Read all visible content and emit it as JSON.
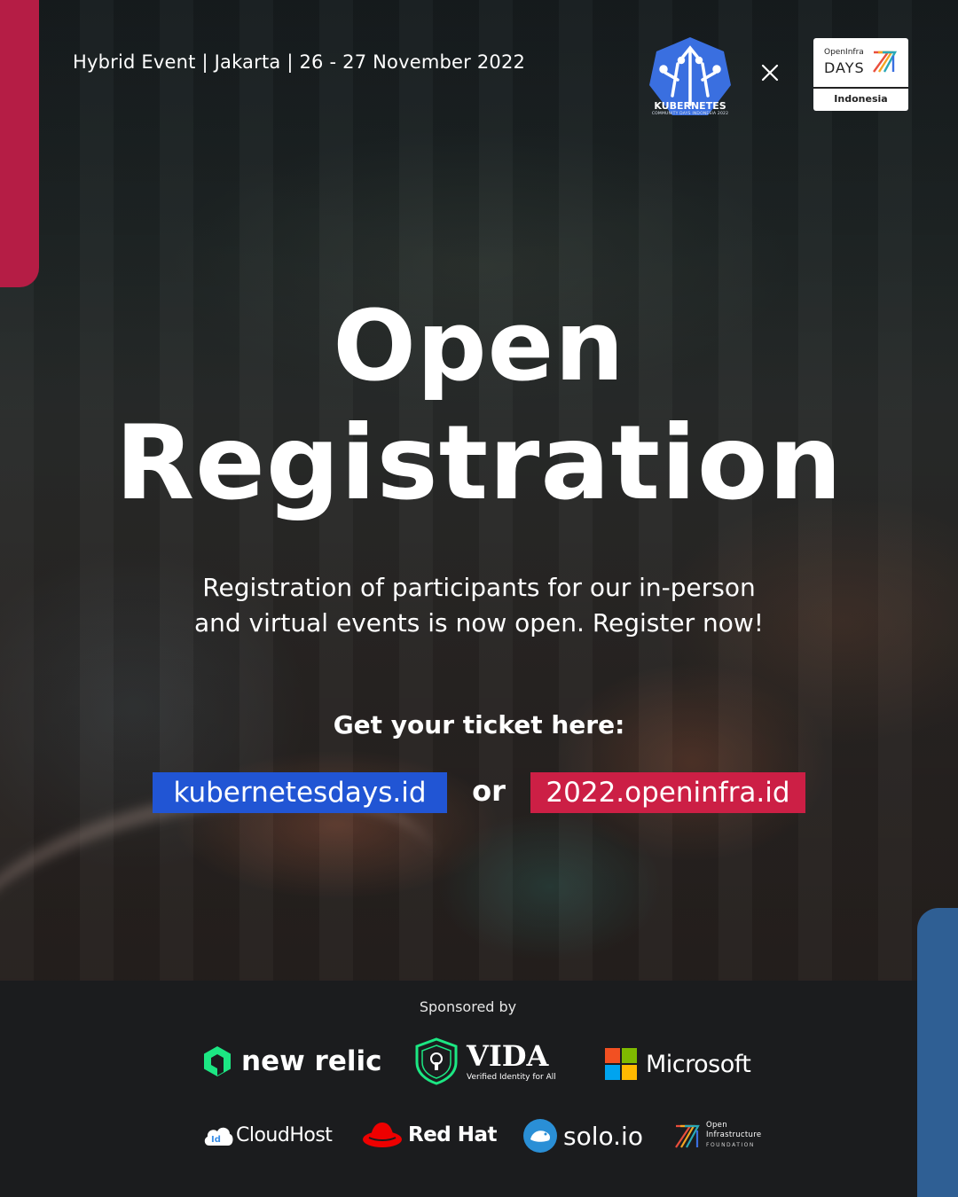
{
  "header": {
    "event_line": "Hybrid Event | Jakarta | 26 - 27 November 2022",
    "kcd_logo": {
      "wordmark": "KUBERNETES",
      "subtitle": "COMMUNITY DAYS INDONESIA 2022",
      "icon": "kubernetes-heptagon-logo"
    },
    "separator_icon": "times-icon",
    "openinfra_badge": {
      "top_text": "OpenInfra",
      "days_text": "DAYS",
      "country": "Indonesia",
      "icon": "openinfra-stripes-logo"
    }
  },
  "headline": {
    "line1": "Open",
    "line2": "Registration"
  },
  "description": {
    "line1": "Registration of participants for our in-person",
    "line2": "and virtual events is now open. Register now!"
  },
  "ticket_prompt": "Get your ticket here:",
  "links": {
    "kubernetes": "kubernetesdays.id",
    "or": "or",
    "openinfra": "2022.openinfra.id"
  },
  "sponsors": {
    "heading": "Sponsored by",
    "row1": [
      {
        "name": "new relic",
        "icon": "new-relic-logo"
      },
      {
        "name": "VIDA",
        "tagline": "Verified Identity for All",
        "icon": "vida-shield-logo"
      },
      {
        "name": "Microsoft",
        "icon": "microsoft-logo"
      }
    ],
    "row2": [
      {
        "name": "CloudHost",
        "badge": "Id",
        "icon": "cloudhost-logo"
      },
      {
        "name": "Red Hat",
        "icon": "redhat-logo"
      },
      {
        "name": "solo.io",
        "icon": "solo-io-logo"
      },
      {
        "name_line1": "Open",
        "name_line2": "Infrastructure",
        "name_line3": "FOUNDATION",
        "icon": "openinfra-foundation-logo"
      }
    ]
  },
  "colors": {
    "accent_red": "#b51d45",
    "accent_blue": "#2f5f94",
    "kube_link_bg": "#2155d4",
    "openinfra_link_bg": "#cc1f45",
    "kube_blue": "#3a6fe0",
    "footer_bg": "#1b1c1e"
  }
}
